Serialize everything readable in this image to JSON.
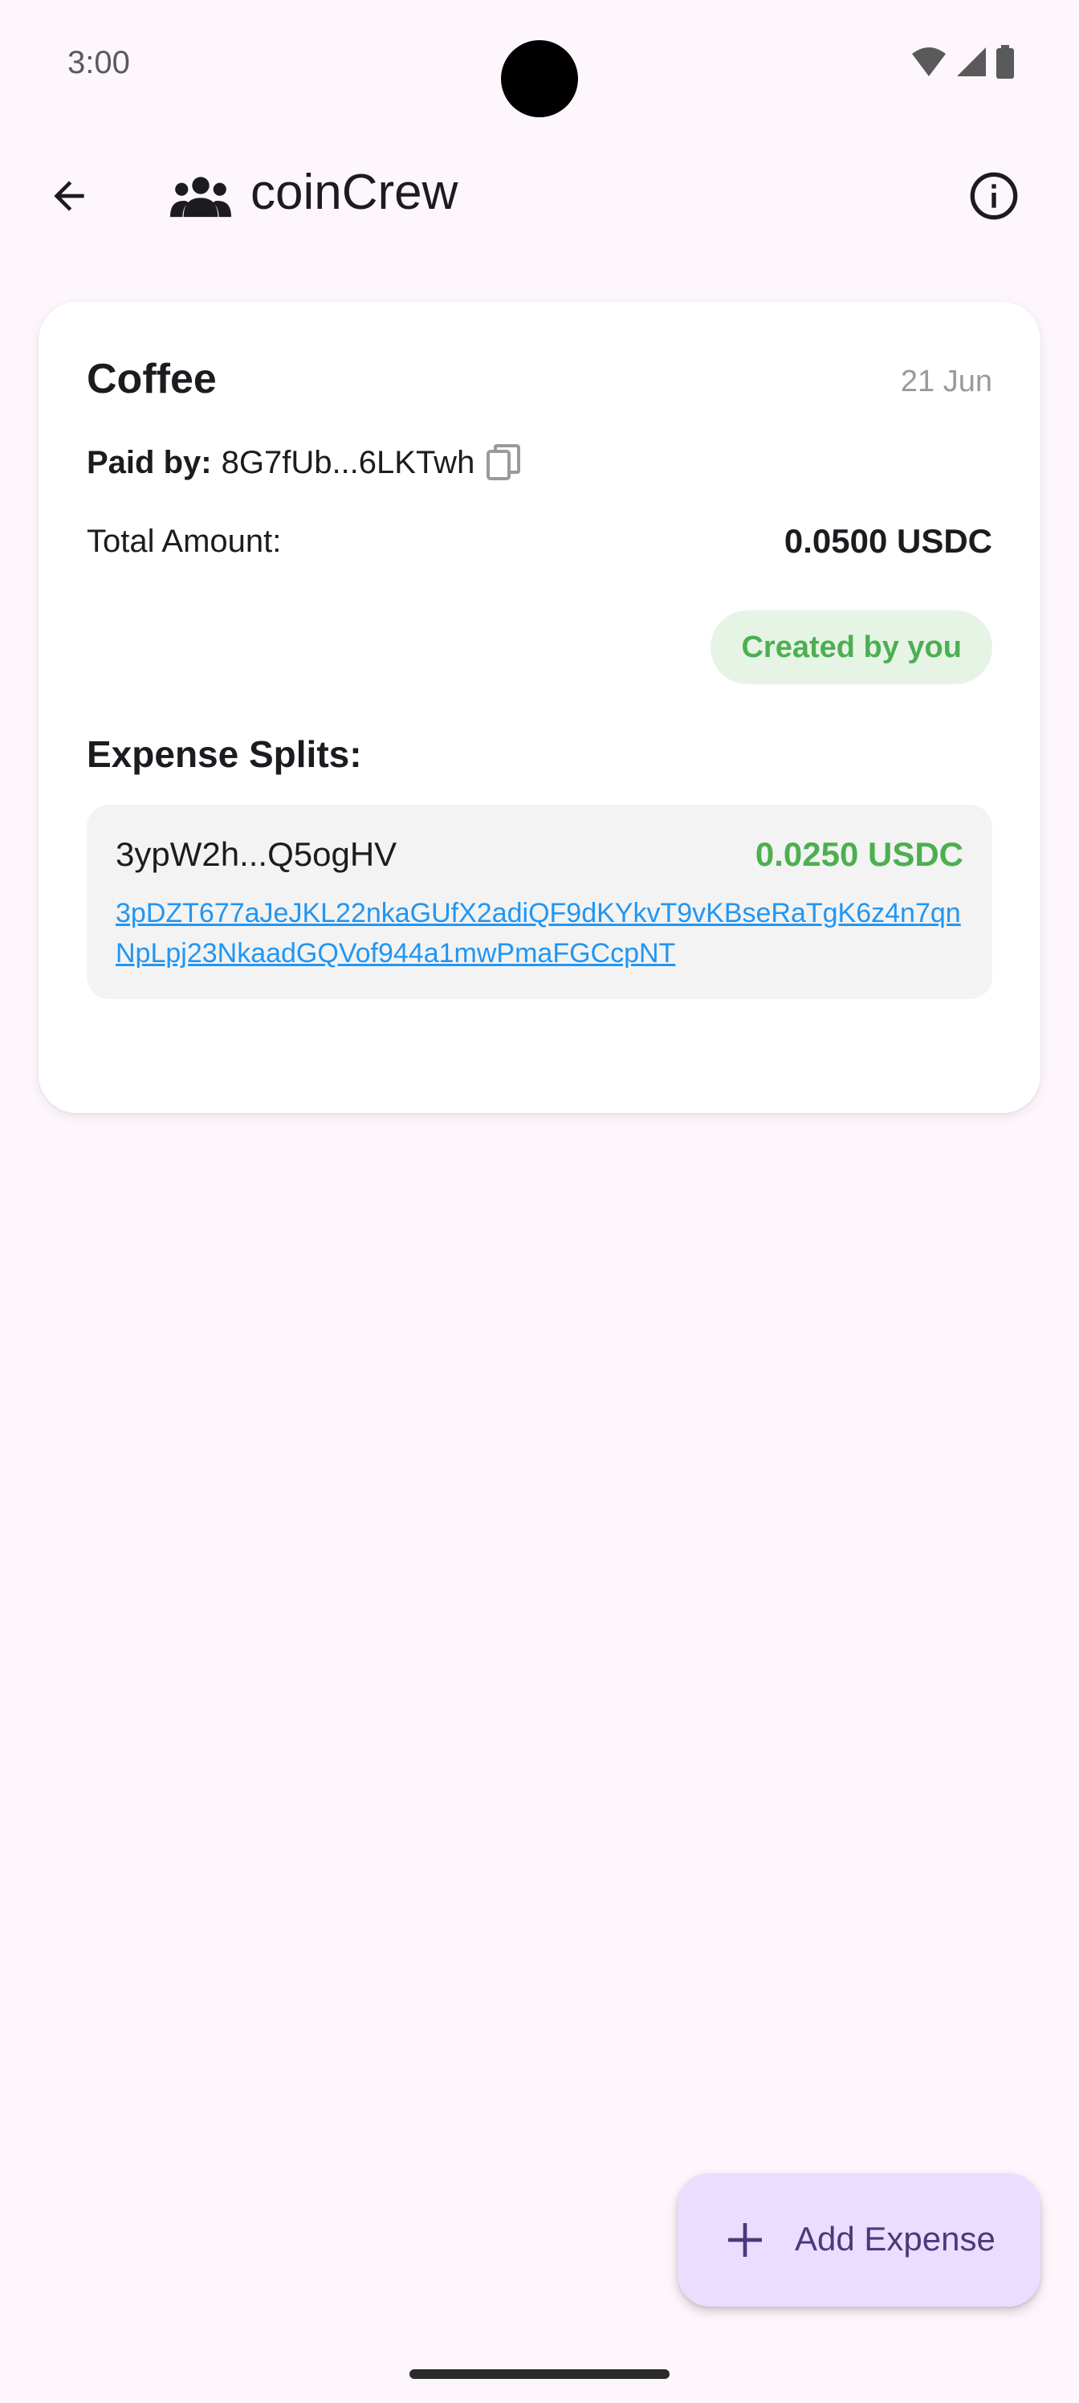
{
  "status_bar": {
    "time": "3:00"
  },
  "app_bar": {
    "title": "coinCrew"
  },
  "expense": {
    "title": "Coffee",
    "date": "21 Jun",
    "paid_by_label": "Paid by:",
    "paid_by_value": "8G7fUb...6LKTwh",
    "total_label": "Total Amount:",
    "total_value": "0.0500 USDC",
    "created_badge": "Created by you",
    "splits_heading": "Expense Splits:",
    "splits": [
      {
        "short_address": "3ypW2h...Q5ogHV",
        "amount": "0.0250 USDC",
        "link": "3pDZT677aJeJKL22nkaGUfX2adiQF9dKYkvT9vKBseRaTgK6z4n7qnNpLpj23NkaadGQVof944a1mwPmaFGCcpNT"
      }
    ]
  },
  "fab": {
    "label": "Add Expense"
  },
  "colors": {
    "background": "#fdf7fd",
    "accent_green": "#4caf50",
    "link_blue": "#2196f3",
    "fab_bg": "#eaddff"
  }
}
